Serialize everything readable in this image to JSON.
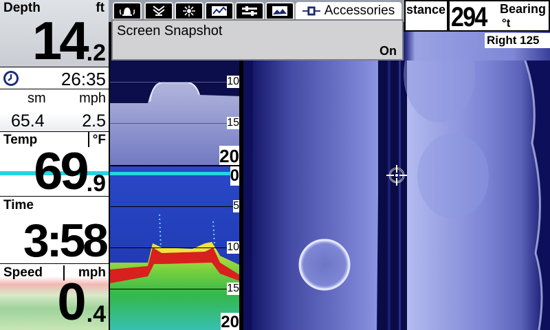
{
  "digital_readouts": {
    "depth": {
      "label": "Depth",
      "unit": "ft",
      "whole": "14",
      "decimal": ".2"
    },
    "clock": {
      "value": "26:35"
    },
    "speed_log": {
      "dist_unit": "sm",
      "speed_unit": "mph",
      "distance": "65.4",
      "speed": "2.5"
    },
    "temp": {
      "label": "Temp",
      "unit": "°F",
      "whole": "69",
      "decimal": ".9"
    },
    "time": {
      "label": "Time",
      "value": "3:58"
    },
    "speed": {
      "label": "Speed",
      "unit": "mph",
      "whole": "0",
      "decimal": ".4"
    }
  },
  "tabs": {
    "accessories_label": "Accessories"
  },
  "popup": {
    "title": "Screen Snapshot",
    "value": "On"
  },
  "nav_info": {
    "distance_label": "stance",
    "bearing_label": "Bearing",
    "bearing_value": "294",
    "bearing_unit": "°t",
    "range_label": "Right  125"
  },
  "down_imaging": {
    "depth_labels": [
      "10",
      "15",
      "20"
    ]
  },
  "sonar_2d": {
    "depth_labels": [
      "0",
      "5",
      "10",
      "15",
      "20"
    ]
  },
  "colors": {
    "cyan_line": "#27d3e0",
    "sonar_red": "#d8201e",
    "sonar_yellow": "#f1e33a",
    "side_image_blue": "#8c95e2"
  }
}
